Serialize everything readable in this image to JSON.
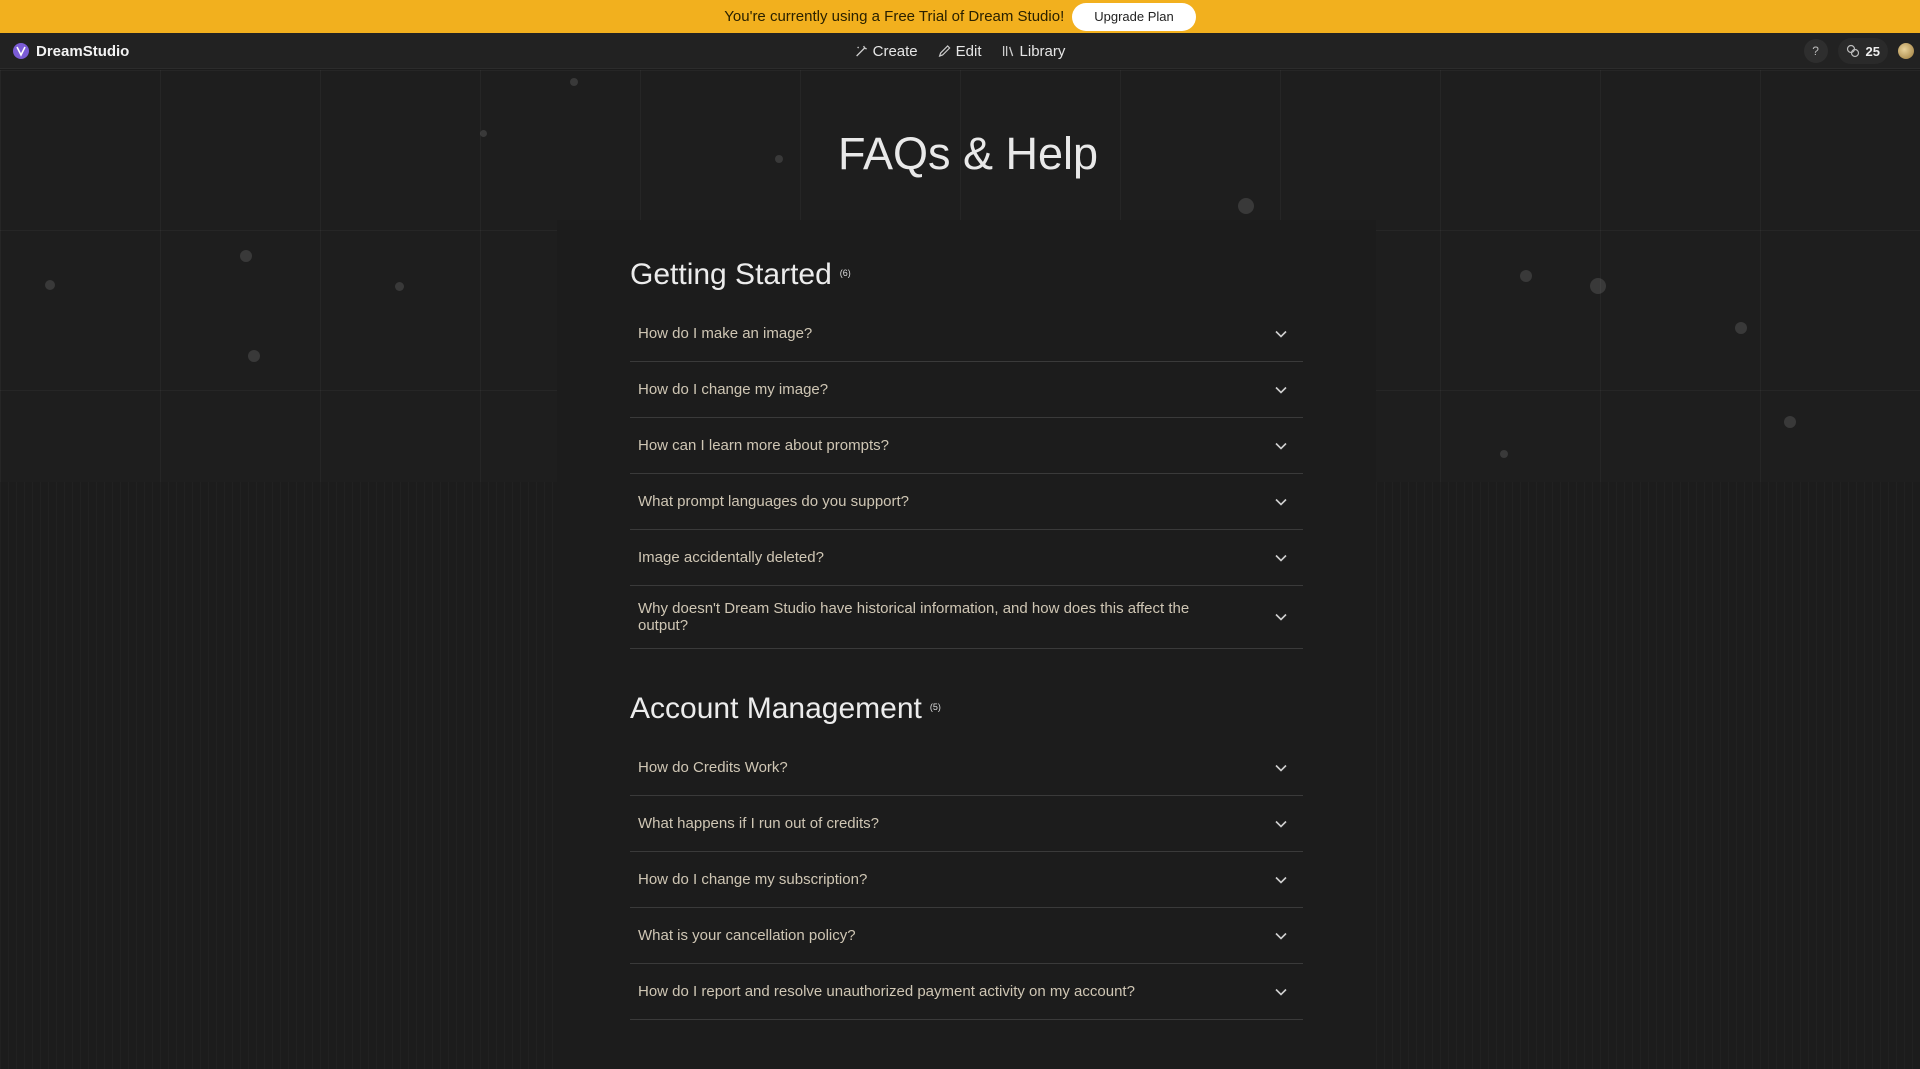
{
  "banner": {
    "message": "You're currently using a Free Trial of Dream Studio!",
    "upgrade_label": "Upgrade Plan",
    "color": "#f2b01e"
  },
  "header": {
    "brand": "DreamStudio",
    "nav": [
      {
        "label": "Create",
        "icon": "wand-icon"
      },
      {
        "label": "Edit",
        "icon": "pencil-icon"
      },
      {
        "label": "Library",
        "icon": "library-icon"
      }
    ],
    "help_label": "?",
    "credits": "25"
  },
  "page": {
    "title": "FAQs & Help"
  },
  "sections": [
    {
      "title": "Getting Started",
      "count": "(6)",
      "items": [
        "How do I make an image?",
        "How do I change my image?",
        "How can I learn more about prompts?",
        "What prompt languages do you support?",
        "Image accidentally deleted?",
        "Why doesn't Dream Studio have historical information, and how does this affect the output?"
      ]
    },
    {
      "title": "Account Management",
      "count": "(5)",
      "items": [
        "How do Credits Work?",
        "What happens if I run out of credits?",
        "How do I change my subscription?",
        "What is your cancellation policy?",
        "How do I report and resolve unauthorized payment activity on my account?"
      ]
    }
  ]
}
